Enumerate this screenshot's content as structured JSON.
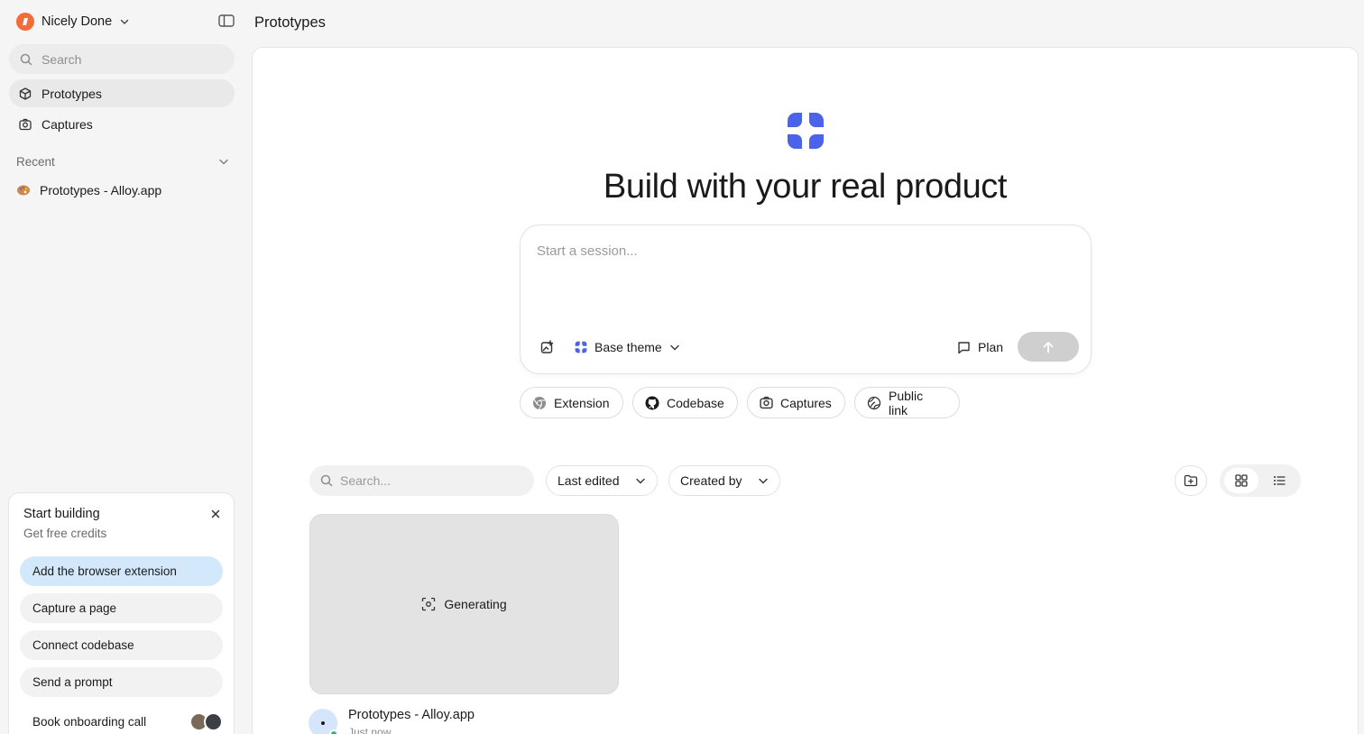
{
  "workspace": {
    "name": "Nicely Done",
    "logo_color": "#f26b3a"
  },
  "sidebar": {
    "search_placeholder": "Search",
    "nav": [
      {
        "label": "Prototypes",
        "icon": "box-icon",
        "active": true
      },
      {
        "label": "Captures",
        "icon": "camera-icon",
        "active": false
      }
    ],
    "recent": {
      "label": "Recent",
      "items": [
        {
          "label": "Prototypes - Alloy.app",
          "icon": "palette-icon"
        }
      ]
    }
  },
  "onboarding": {
    "title": "Start building",
    "subtitle": "Get free credits",
    "steps": [
      {
        "label": "Add the browser extension",
        "highlighted": true
      },
      {
        "label": "Capture a page"
      },
      {
        "label": "Connect codebase"
      },
      {
        "label": "Send a prompt"
      },
      {
        "label": "Book onboarding call"
      }
    ]
  },
  "header": {
    "title": "Prototypes"
  },
  "main": {
    "hero": "Build with your real product",
    "composer": {
      "placeholder": "Start a session...",
      "theme_label": "Base theme",
      "plan_label": "Plan"
    },
    "chips": [
      {
        "label": "Extension",
        "icon": "chrome-icon"
      },
      {
        "label": "Codebase",
        "icon": "github-icon"
      },
      {
        "label": "Captures",
        "icon": "camera-icon"
      },
      {
        "label": "Public link",
        "icon": "globe-link-icon"
      }
    ],
    "filters": {
      "search_placeholder": "Search...",
      "sort_label": "Last edited",
      "created_label": "Created by"
    },
    "cards": [
      {
        "status": "Generating",
        "title": "Prototypes - Alloy.app",
        "subtitle": "Just now"
      }
    ]
  },
  "colors": {
    "brand": "#4b63e8",
    "onboard_highlight": "#d4e8fb",
    "send_disabled": "#cfcfcf",
    "online": "#2bb673"
  }
}
